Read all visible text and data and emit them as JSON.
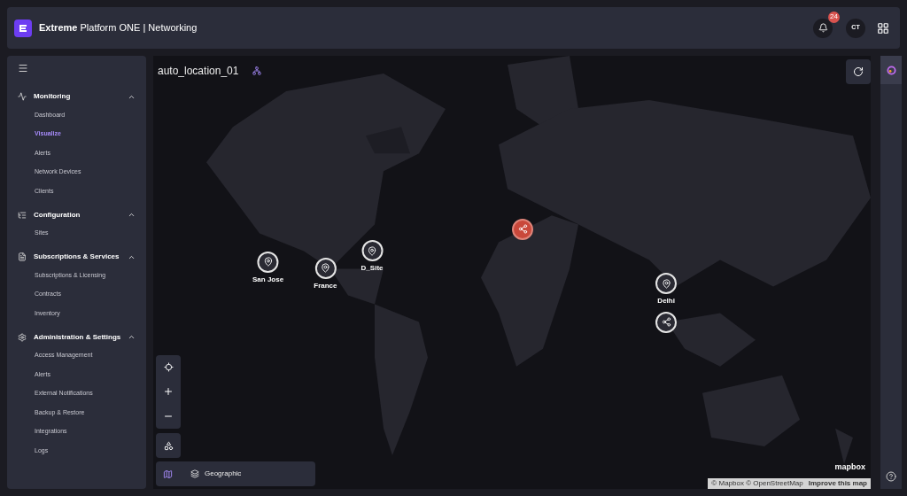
{
  "header": {
    "brand_bold": "Extreme",
    "brand_rest": "Platform ONE",
    "separator": "|",
    "product": "Networking",
    "notification_count": "24",
    "avatar": "CT"
  },
  "sidebar": {
    "sections": [
      {
        "title": "Monitoring",
        "expanded": true,
        "items": [
          {
            "label": "Dashboard",
            "selected": false
          },
          {
            "label": "Visualize",
            "selected": true
          },
          {
            "label": "Alerts",
            "selected": false
          },
          {
            "label": "Network Devices",
            "selected": false
          },
          {
            "label": "Clients",
            "selected": false
          }
        ]
      },
      {
        "title": "Configuration",
        "expanded": true,
        "items": [
          {
            "label": "Sites",
            "selected": false
          }
        ]
      },
      {
        "title": "Subscriptions & Services",
        "expanded": true,
        "items": [
          {
            "label": "Subscriptions & Licensing",
            "selected": false
          },
          {
            "label": "Contracts",
            "selected": false
          },
          {
            "label": "Inventory",
            "selected": false
          }
        ]
      },
      {
        "title": "Administration & Settings",
        "expanded": true,
        "items": [
          {
            "label": "Access Management",
            "selected": false
          },
          {
            "label": "Alerts",
            "selected": false
          },
          {
            "label": "External Notifications",
            "selected": false
          },
          {
            "label": "Backup & Restore",
            "selected": false
          },
          {
            "label": "Integrations",
            "selected": false
          },
          {
            "label": "Logs",
            "selected": false
          }
        ]
      }
    ]
  },
  "map": {
    "title": "auto_location_01",
    "markers": [
      {
        "kind": "site",
        "label": "San Jose",
        "selected": false
      },
      {
        "kind": "site",
        "label": "France",
        "selected": false
      },
      {
        "kind": "site",
        "label": "D_Site",
        "selected": false
      },
      {
        "kind": "cluster",
        "selected": true
      },
      {
        "kind": "site",
        "label": "Delhi",
        "selected": false
      },
      {
        "kind": "cluster",
        "selected": false
      }
    ],
    "layer": "Geographic",
    "logo": "mapbox",
    "attribution": "© Mapbox © OpenStreetMap",
    "improve_link": "Improve this map"
  }
}
